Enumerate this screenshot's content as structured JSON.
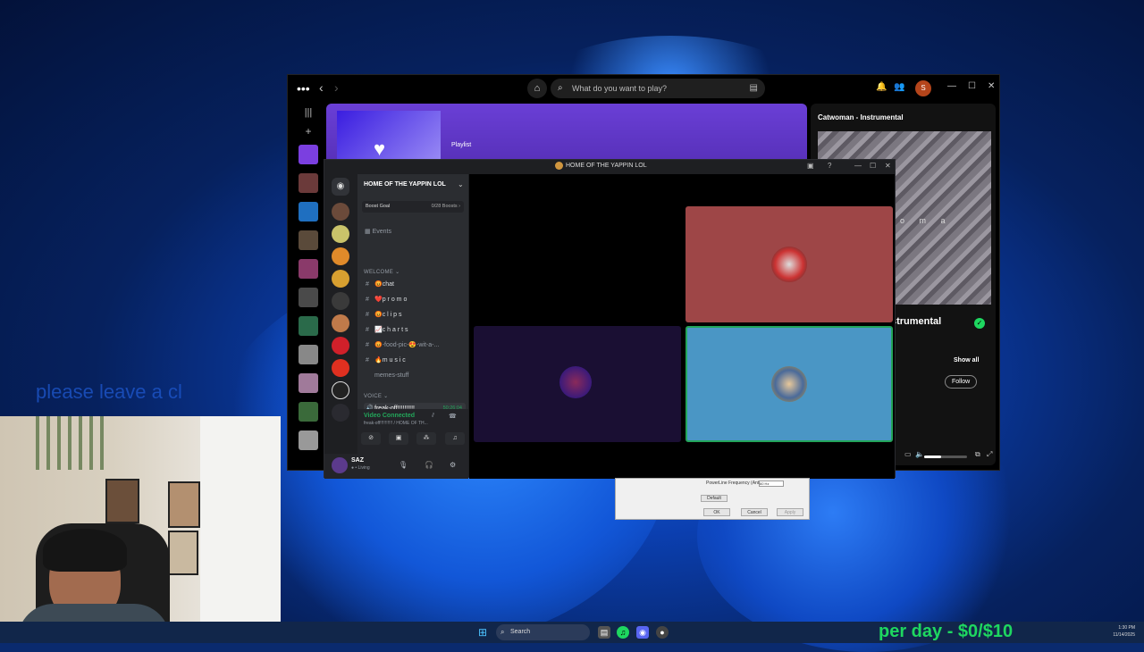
{
  "desktop": {
    "overlay_text": "please leave a cl"
  },
  "spotify": {
    "search_placeholder": "What do you want to play?",
    "avatar_initial": "S",
    "main": {
      "playlist_label": "Playlist"
    },
    "now_playing": {
      "title": "Catwoman - Instrumental",
      "art_text": "o m a",
      "track_partial": "strumental",
      "show_all": "Show all",
      "follow": "Follow"
    }
  },
  "discord": {
    "window_title": "HOME OF THE YAPPIN LOL",
    "server_name": "HOME OF THE YAPPIN LOL",
    "boost_goal": "Boost Goal",
    "boost_count": "0/28 Boosts ›",
    "events": "Events",
    "category_welcome": "WELCOME ⌄",
    "channels": [
      {
        "name": "😡chat"
      },
      {
        "name": "❤️p r o m o"
      },
      {
        "name": "😡c l i p s"
      },
      {
        "name": "📈c h a r t s"
      },
      {
        "name": "😡-food-pic-😍-wit-a-..."
      },
      {
        "name": "🔥m u s i c"
      },
      {
        "name": "memes-stuff"
      }
    ],
    "category_voice": "VOICE ⌄",
    "voice_channel": {
      "name": "freak-off!!!!!!!!!!",
      "time": "50:26:04"
    },
    "voice_panel": {
      "status": "Video Connected",
      "sub": "freak-off!!!!!!!!!! / HOME OF TH..."
    },
    "user": {
      "name": "SAZ",
      "status": "● • Living"
    }
  },
  "dialog": {
    "label": "PowerLine Frequency\n(Anti Flicker)",
    "select_value": "60 Hz",
    "default_label": "Default",
    "ok": "OK",
    "cancel": "Cancel",
    "apply": "Apply"
  },
  "taskbar": {
    "search_label": "Search",
    "time": "1:30 PM",
    "date": "11/14/2025"
  },
  "stream": {
    "donation": "per day - $0/$10"
  },
  "colors": {
    "spotify_green": "#1ed760",
    "discord_green": "#23a55a",
    "banner_purple": "#5a33c2"
  }
}
